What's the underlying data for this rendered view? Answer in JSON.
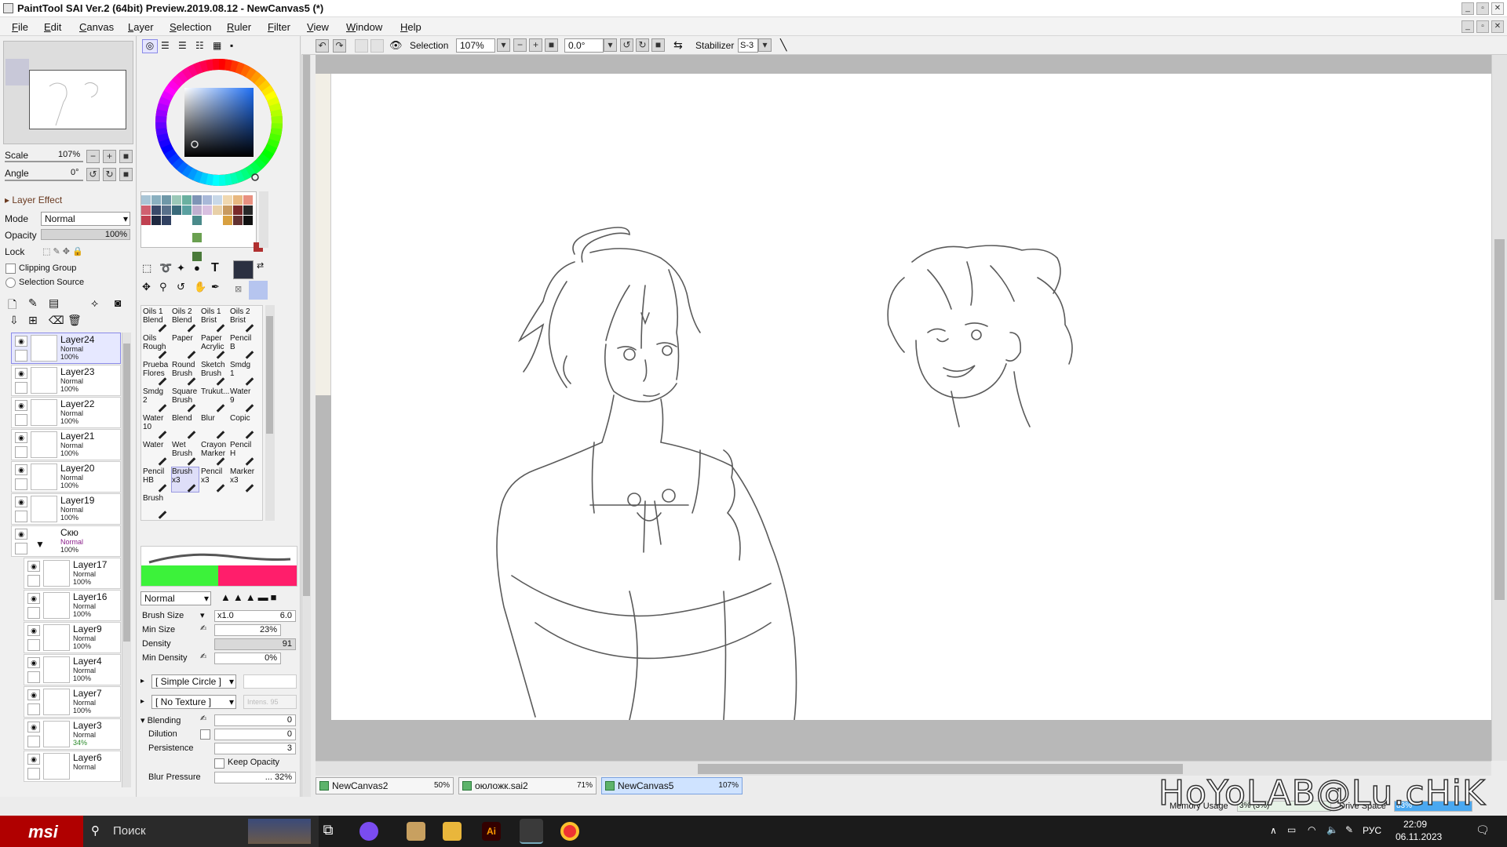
{
  "window": {
    "title": "PaintTool SAI Ver.2 (64bit) Preview.2019.08.12 - NewCanvas5 (*)"
  },
  "menu": [
    "File",
    "Edit",
    "Canvas",
    "Layer",
    "Selection",
    "Ruler",
    "Filter",
    "View",
    "Window",
    "Help"
  ],
  "navigator": {
    "scale_label": "Scale",
    "scale_value": "107%",
    "angle_label": "Angle",
    "angle_value": "0°"
  },
  "layer_effect": {
    "header": "Layer Effect",
    "mode_label": "Mode",
    "mode_value": "Normal",
    "opacity_label": "Opacity",
    "opacity_value": "100%",
    "lock_label": "Lock",
    "clipping_group": "Clipping Group",
    "selection_source": "Selection Source"
  },
  "layers": [
    {
      "name": "Layer24",
      "mode": "Normal",
      "opacity": "100%",
      "selected": true
    },
    {
      "name": "Layer23",
      "mode": "Normal",
      "opacity": "100%"
    },
    {
      "name": "Layer22",
      "mode": "Normal",
      "opacity": "100%"
    },
    {
      "name": "Layer21",
      "mode": "Normal",
      "opacity": "100%"
    },
    {
      "name": "Layer20",
      "mode": "Normal",
      "opacity": "100%"
    },
    {
      "name": "Layer19",
      "mode": "Normal",
      "opacity": "100%"
    },
    {
      "name": "Скю",
      "mode": "Normal",
      "opacity": "100%",
      "folder": true
    },
    {
      "name": "Layer17",
      "mode": "Normal",
      "opacity": "100%"
    },
    {
      "name": "Layer16",
      "mode": "Normal",
      "opacity": "100%"
    },
    {
      "name": "Layer9",
      "mode": "Normal",
      "opacity": "100%"
    },
    {
      "name": "Layer4",
      "mode": "Normal",
      "opacity": "100%"
    },
    {
      "name": "Layer7",
      "mode": "Normal",
      "opacity": "100%"
    },
    {
      "name": "Layer3",
      "mode": "Normal",
      "opacity": "34%"
    },
    {
      "name": "Layer6",
      "mode": "Normal",
      "opacity": ""
    }
  ],
  "brushes": [
    [
      "Oils 1 Blend",
      "Oils 2 Blend",
      "Oils 1 Brist",
      "Oils 2 Brist"
    ],
    [
      "Oils Rough",
      "Paper",
      "Paper Acrylic",
      "Pencil B"
    ],
    [
      "Prueba Flores",
      "Round Brush",
      "Sketch Brush",
      "Smdg 1"
    ],
    [
      "Smdg 2",
      "Square Brush",
      "Trukut...",
      "Water 9"
    ],
    [
      "Water 10",
      "Blend",
      "Blur",
      "Copic"
    ],
    [
      "Water",
      "Wet Brush",
      "Crayon Marker",
      "Pencil H"
    ],
    [
      "Pencil HB",
      "Brush x3",
      "Pencil x3",
      "Marker x3"
    ],
    [
      "Brush",
      "",
      "",
      ""
    ]
  ],
  "brush_settings": {
    "mode": "Normal",
    "size_label": "Brush Size",
    "size_mult": "x1.0",
    "size_value": "6.0",
    "min_size_label": "Min Size",
    "min_size_value": "23%",
    "density_label": "Density",
    "density_value": "91",
    "min_density_label": "Min Density",
    "min_density_value": "0%",
    "shape": "[ Simple Circle ]",
    "texture": "[ No Texture ]",
    "texture_intensity": "Intens. 95",
    "blending_label": "Blending",
    "blending_value": "0",
    "dilution_label": "Dilution",
    "dilution_value": "0",
    "persistence_label": "Persistence",
    "persistence_value": "3",
    "keep_opacity": "Keep Opacity",
    "blur_pressure_label": "Blur Pressure",
    "blur_pressure_value": "... 32%"
  },
  "toolbar": {
    "selection_label": "Selection",
    "zoom": "107%",
    "angle": "0.0°",
    "stabilizer_label": "Stabilizer",
    "stabilizer_value": "S-3"
  },
  "tabs": [
    {
      "name": "NewCanvas2",
      "zoom": "50%"
    },
    {
      "name": "оюложк.sai2",
      "zoom": "71%"
    },
    {
      "name": "NewCanvas5",
      "zoom": "107%",
      "active": true
    }
  ],
  "status": {
    "memory": "Memory Usage",
    "memory_value": "3% (3%)",
    "drive": "Drive Space",
    "drive_value": "83%",
    "watermark": "HoYoLAB@Lu.cHiK"
  },
  "taskbar": {
    "search": "Поиск",
    "lang": "РУС",
    "time": "22:09",
    "date": "06.11.2023",
    "brand": "msi"
  },
  "colors": {
    "accent": "#8a8ae8",
    "fg_color": "#2b3040",
    "brush_main": "#3cf23a",
    "brush_alt": "#ff1e6b",
    "taskbar": "#1b1b1b"
  }
}
